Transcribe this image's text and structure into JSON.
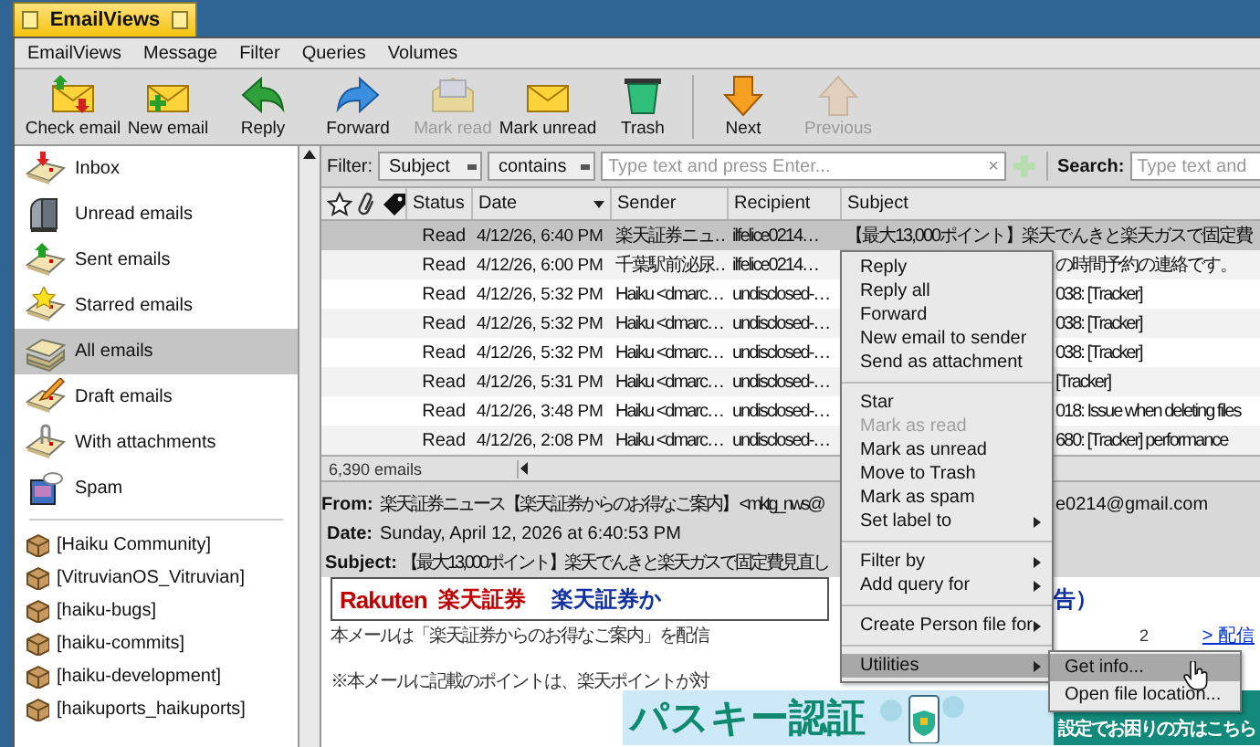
{
  "window": {
    "title": "EmailViews"
  },
  "menu_bar": [
    {
      "label": "EmailViews"
    },
    {
      "label": "Message"
    },
    {
      "label": "Filter"
    },
    {
      "label": "Queries"
    },
    {
      "label": "Volumes"
    }
  ],
  "toolbar": [
    [
      {
        "label": "Check email",
        "kind": "check",
        "disabled": false
      },
      {
        "label": "New email",
        "kind": "new",
        "disabled": false
      },
      {
        "label": "Reply",
        "kind": "reply",
        "disabled": false
      },
      {
        "label": "Forward",
        "kind": "forward",
        "disabled": false
      },
      {
        "label": "Mark read",
        "kind": "markread",
        "disabled": true
      },
      {
        "label": "Mark unread",
        "kind": "markunread",
        "disabled": false
      },
      {
        "label": "Trash",
        "kind": "trash",
        "disabled": false
      }
    ],
    [
      {
        "label": "Next",
        "kind": "next",
        "disabled": false
      },
      {
        "label": "Previous",
        "kind": "previous",
        "disabled": true
      }
    ]
  ],
  "sidebar": {
    "mailboxes": [
      {
        "label": "Inbox",
        "kind": "inbox",
        "selected": false
      },
      {
        "label": "Unread emails",
        "kind": "unread",
        "selected": false
      },
      {
        "label": "Sent emails",
        "kind": "sent",
        "selected": false
      },
      {
        "label": "Starred emails",
        "kind": "starred",
        "selected": false
      },
      {
        "label": "All emails",
        "kind": "all",
        "selected": true
      },
      {
        "label": "Draft emails",
        "kind": "draft",
        "selected": false
      },
      {
        "label": "With attachments",
        "kind": "attachments",
        "selected": false
      },
      {
        "label": "Spam",
        "kind": "spam",
        "selected": false
      }
    ],
    "folders": [
      {
        "label": "[Haiku Community]"
      },
      {
        "label": "[VitruvianOS_Vitruvian]"
      },
      {
        "label": "[haiku-bugs]"
      },
      {
        "label": "[haiku-commits]"
      },
      {
        "label": "[haiku-development]"
      },
      {
        "label": "[haikuports_haikuports]"
      }
    ]
  },
  "filter": {
    "label": "Filter:",
    "field": "Subject",
    "operator": "contains",
    "placeholder": "Type text and press Enter...",
    "clear": "×"
  },
  "search": {
    "label": "Search:",
    "placeholder": "Type text and"
  },
  "table": {
    "columns": [
      {
        "label": "Status",
        "sorted": false
      },
      {
        "label": "Date",
        "sorted": true
      },
      {
        "label": "Sender",
        "sorted": false
      },
      {
        "label": "Recipient",
        "sorted": false
      },
      {
        "label": "Subject",
        "sorted": false
      }
    ],
    "rows": [
      {
        "status": "Read",
        "date": "4/12/26, 6:40 PM",
        "sender": "楽天証券ニュ…",
        "recipient": "ilfelice0214…",
        "subject": "【最大13,000ポイント】楽天でんきと楽天ガスで固定費",
        "selected": true
      },
      {
        "status": "Read",
        "date": "4/12/26, 6:00 PM",
        "sender": "千葉駅前泌尿…",
        "recipient": "ilfelice0214…",
        "subject": "の時間予約の連絡です。",
        "selected": false
      },
      {
        "status": "Read",
        "date": "4/12/26, 5:32 PM",
        "sender": "Haiku <dmarc…",
        "recipient": "undisclosed-…",
        "subject": "038: [Tracker]",
        "selected": false
      },
      {
        "status": "Read",
        "date": "4/12/26, 5:32 PM",
        "sender": "Haiku <dmarc…",
        "recipient": "undisclosed-…",
        "subject": "038: [Tracker]",
        "selected": false
      },
      {
        "status": "Read",
        "date": "4/12/26, 5:32 PM",
        "sender": "Haiku <dmarc…",
        "recipient": "undisclosed-…",
        "subject": "038: [Tracker]",
        "selected": false
      },
      {
        "status": "Read",
        "date": "4/12/26, 5:31 PM",
        "sender": "Haiku <dmarc…",
        "recipient": "undisclosed-…",
        "subject": "[Tracker]",
        "selected": false
      },
      {
        "status": "Read",
        "date": "4/12/26, 3:48 PM",
        "sender": "Haiku <dmarc…",
        "recipient": "undisclosed-…",
        "subject": "018: Issue when deleting files",
        "selected": false
      },
      {
        "status": "Read",
        "date": "4/12/26, 2:08 PM",
        "sender": "Haiku <dmarc…",
        "recipient": "undisclosed-…",
        "subject": "680: [Tracker] performance",
        "selected": false
      }
    ],
    "count": "6,390 emails"
  },
  "message": {
    "from_label": "From:",
    "from": "楽天証券ニュース【楽天証券からのお得なご案内】 <mktg_nws@",
    "from_tail": "e0214@gmail.com",
    "date_label": "Date:",
    "date": "Sunday, April 12, 2026 at 6:40:53 PM",
    "subject_label": "Subject:",
    "subject": "【最大13,000ポイント】楽天でんきと楽天ガスで固定費見直し"
  },
  "body": {
    "brand": "Rakuten",
    "brand_jp": "楽天証券",
    "headline": "楽天証券か",
    "headline_tail": "告）",
    "line1": "本メールは「楽天証券からのお得なご案内」を配信",
    "line1_tail": "2",
    "link": "> 配信",
    "line2": "※本メールに記載のポイントは、楽天ポイントが対",
    "banner_title": "パスキー認証",
    "banner_cta": "設定でお困りの方はこちら"
  },
  "context_menu": [
    [
      {
        "label": "Reply",
        "disabled": false,
        "submenu": false,
        "selected": false
      },
      {
        "label": "Reply all",
        "disabled": false,
        "submenu": false,
        "selected": false
      },
      {
        "label": "Forward",
        "disabled": false,
        "submenu": false,
        "selected": false
      },
      {
        "label": "New email to sender",
        "disabled": false,
        "submenu": false,
        "selected": false
      },
      {
        "label": "Send as attachment",
        "disabled": false,
        "submenu": false,
        "selected": false
      }
    ],
    [
      {
        "label": "Star",
        "disabled": false,
        "submenu": false,
        "selected": false
      },
      {
        "label": "Mark as read",
        "disabled": true,
        "submenu": false,
        "selected": false
      },
      {
        "label": "Mark as unread",
        "disabled": false,
        "submenu": false,
        "selected": false
      },
      {
        "label": "Move to Trash",
        "disabled": false,
        "submenu": false,
        "selected": false
      },
      {
        "label": "Mark as spam",
        "disabled": false,
        "submenu": false,
        "selected": false
      },
      {
        "label": "Set label to",
        "disabled": false,
        "submenu": true,
        "selected": false
      }
    ],
    [
      {
        "label": "Filter by",
        "disabled": false,
        "submenu": true,
        "selected": false
      },
      {
        "label": "Add query for",
        "disabled": false,
        "submenu": true,
        "selected": false
      }
    ],
    [
      {
        "label": "Create Person file for",
        "disabled": false,
        "submenu": true,
        "selected": false
      }
    ],
    [
      {
        "label": "Utilities",
        "disabled": false,
        "submenu": true,
        "selected": true
      }
    ]
  ],
  "submenu": [
    {
      "label": "Get info...",
      "selected": true
    },
    {
      "label": "Open file location...",
      "selected": false
    }
  ]
}
